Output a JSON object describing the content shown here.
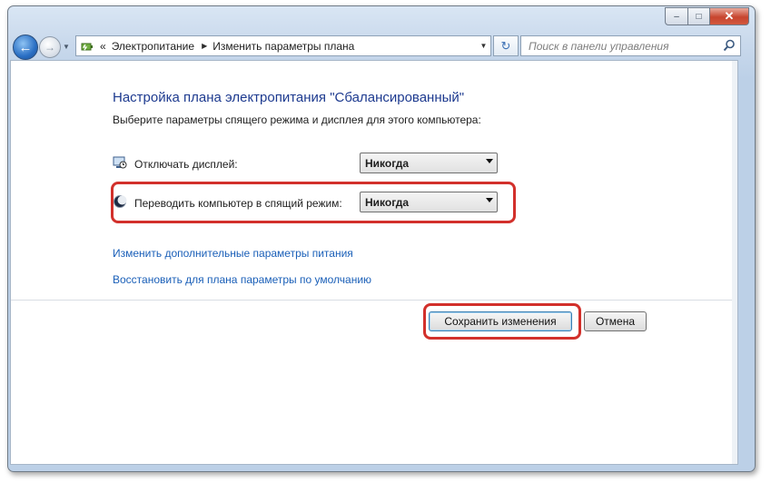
{
  "window": {
    "caption_buttons": {
      "minimize": "–",
      "maximize": "□",
      "close": "✕"
    }
  },
  "nav": {
    "back_glyph": "←",
    "forward_glyph": "→",
    "address": {
      "overflow": "«",
      "crumbs": [
        "Электропитание",
        "Изменить параметры плана"
      ],
      "separator": "▶"
    },
    "refresh_glyph": "↻",
    "search_placeholder": "Поиск в панели управления"
  },
  "page": {
    "heading": "Настройка плана электропитания \"Сбалансированный\"",
    "subtitle": "Выберите параметры спящего режима и дисплея для этого компьютера:",
    "settings": [
      {
        "label": "Отключать дисплей:",
        "value": "Никогда",
        "icon": "display-timer-icon"
      },
      {
        "label": "Переводить компьютер в спящий режим:",
        "value": "Никогда",
        "icon": "moon-icon"
      }
    ],
    "links": [
      "Изменить дополнительные параметры питания",
      "Восстановить для плана параметры по умолчанию"
    ],
    "buttons": {
      "save": "Сохранить изменения",
      "cancel": "Отмена"
    }
  },
  "colors": {
    "heading": "#1d3a8f",
    "link": "#1a5fb8",
    "highlight": "#d2302b"
  }
}
